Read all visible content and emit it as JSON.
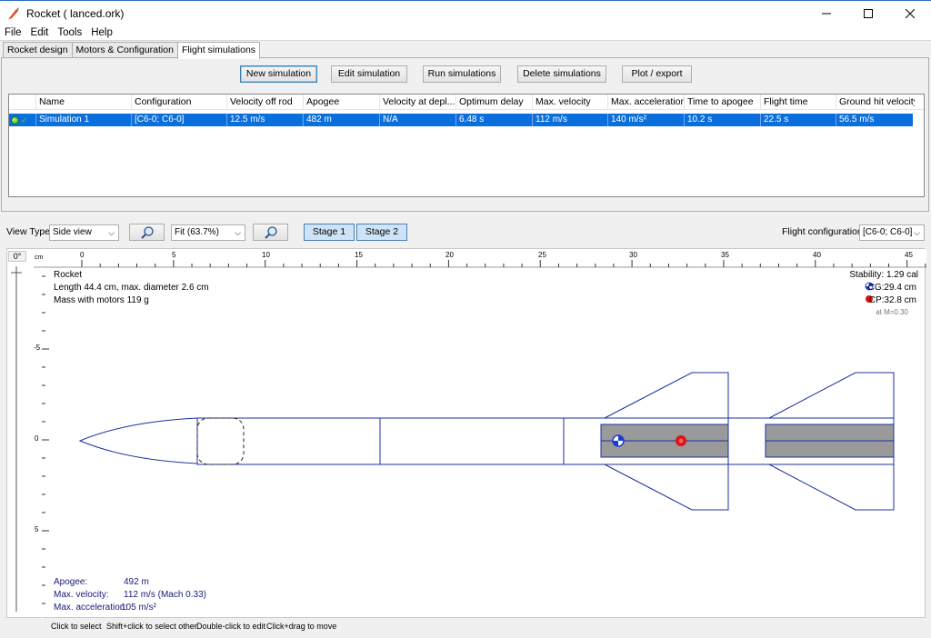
{
  "window": {
    "title": "Rocket ( lanced.ork)"
  },
  "menu": [
    "File",
    "Edit",
    "Tools",
    "Help"
  ],
  "tabs": [
    "Rocket design",
    "Motors & Configuration",
    "Flight simulations"
  ],
  "toolbar": {
    "new": "New simulation",
    "edit": "Edit simulation",
    "run": "Run simulations",
    "delete": "Delete simulations",
    "plot": "Plot / export"
  },
  "table": {
    "headers": [
      "Name",
      "Configuration",
      "Velocity off rod",
      "Apogee",
      "Velocity at depl...",
      "Optimum delay",
      "Max. velocity",
      "Max. acceleration",
      "Time to apogee",
      "Flight time",
      "Ground hit velocity"
    ],
    "rows": [
      [
        "Simulation 1",
        "[C6-0; C6-0]",
        "12.5 m/s",
        "482 m",
        "N/A",
        "6.48 s",
        "112 m/s",
        "140 m/s²",
        "10.2 s",
        "22.5 s",
        "56.5 m/s"
      ]
    ]
  },
  "figure_toolbar": {
    "view_type_label": "View Type:",
    "view_type_value": "Side view",
    "zoom_value": "Fit (63.7%)",
    "stage1": "Stage 1",
    "stage2": "Stage 2",
    "flight_config_label": "Flight configuration:",
    "flight_config_value": "[C6-0; C6-0]"
  },
  "rotation": {
    "angle": "0°"
  },
  "ruler": {
    "unit": "cm",
    "h_labels": [
      "0",
      "5",
      "10",
      "15",
      "20",
      "25",
      "30",
      "35",
      "40",
      "45"
    ],
    "v_labels": [
      "-5",
      "0",
      "5"
    ]
  },
  "rocket_info": {
    "name": "Rocket",
    "dimensions": "Length 44.4 cm, max. diameter 2.6 cm",
    "mass": "Mass with motors 119 g",
    "stability": "Stability: 1.29 cal",
    "cg": "CG:29.4 cm",
    "cp": "CP:32.8 cm",
    "mach": "at M=0.30"
  },
  "flight_info": {
    "apogee_label": "Apogee:",
    "apogee_value": "492 m",
    "velocity_label": "Max. velocity:",
    "velocity_value": "112 m/s  (Mach 0.33)",
    "accel_label": "Max. acceleration:",
    "accel_value": "105 m/s²"
  },
  "status_hints": [
    "Click to select",
    "Shift+click to select other",
    "Double-click to edit",
    "Click+drag to move"
  ],
  "colors": {
    "selection": "#0a6fdc",
    "outline": "#1c2fa0",
    "motor_fill": "#9a9a9a",
    "cp_red": "#e01010",
    "cg_blue": "#1a3cd0"
  }
}
